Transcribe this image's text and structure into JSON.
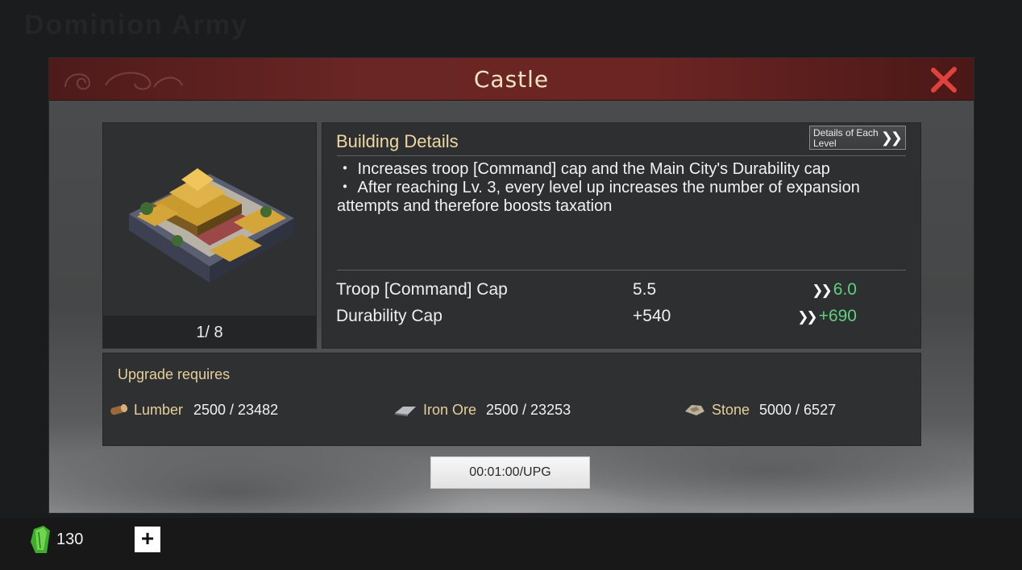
{
  "background": {
    "title": "Dominion Army"
  },
  "dialog": {
    "title": "Castle",
    "close_icon": "close-x-icon",
    "accent_title_bg": "#6a2624",
    "accent_close": "#e0413a"
  },
  "building": {
    "image_icon": "castle-building-icon",
    "level": "1/ 8"
  },
  "details": {
    "heading": "Building Details",
    "levels_button": "Details of Each Level",
    "levels_button_icon": "double-chevron-right-icon",
    "description": [
      "・ Increases troop [Command] cap and the Main City's Durability cap",
      "・ After reaching Lv. 3, every level up increases the number of expansion attempts and therefore boosts taxation"
    ],
    "stats": [
      {
        "name": "Troop [Command] Cap",
        "current": "5.5",
        "next": "6.0"
      },
      {
        "name": "Durability Cap",
        "current": "+540",
        "next": "+690"
      }
    ],
    "next_value_color": "#5fd17e"
  },
  "requirements": {
    "title": "Upgrade requires",
    "resources": [
      {
        "icon": "lumber-icon",
        "name": "Lumber",
        "amount": "2500 / 23482"
      },
      {
        "icon": "iron-ore-icon",
        "name": "Iron Ore",
        "amount": "2500 / 23253"
      },
      {
        "icon": "stone-icon",
        "name": "Stone",
        "amount": "5000 / 6527"
      }
    ]
  },
  "upgrade_button": {
    "label": "00:01:00/UPG"
  },
  "bottom_bar": {
    "currency_icon": "jade-currency-icon",
    "currency_value": "130",
    "add_icon": "plus-icon"
  }
}
